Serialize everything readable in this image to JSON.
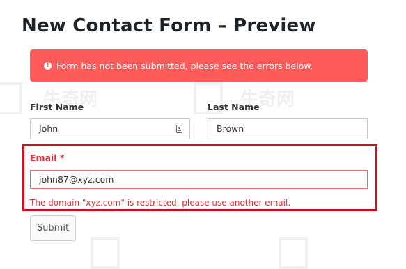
{
  "page": {
    "title": "New Contact Form – Preview"
  },
  "alert": {
    "icon": "alert-circle-icon",
    "icon_glyph": "!",
    "message": "Form has not been submitted, please see the errors below.",
    "background": "#fd5a5a"
  },
  "form": {
    "first_name": {
      "label": "First Name",
      "value": "John"
    },
    "last_name": {
      "label": "Last Name",
      "value": "Brown"
    },
    "email": {
      "label": "Email *",
      "value": "john87@xyz.com",
      "error": "The domain \"xyz.com\" is restricted, please use another email."
    },
    "submit_label": "Submit"
  },
  "colors": {
    "error_text": "#e02f3a",
    "highlight_border": "#d40e1c"
  }
}
